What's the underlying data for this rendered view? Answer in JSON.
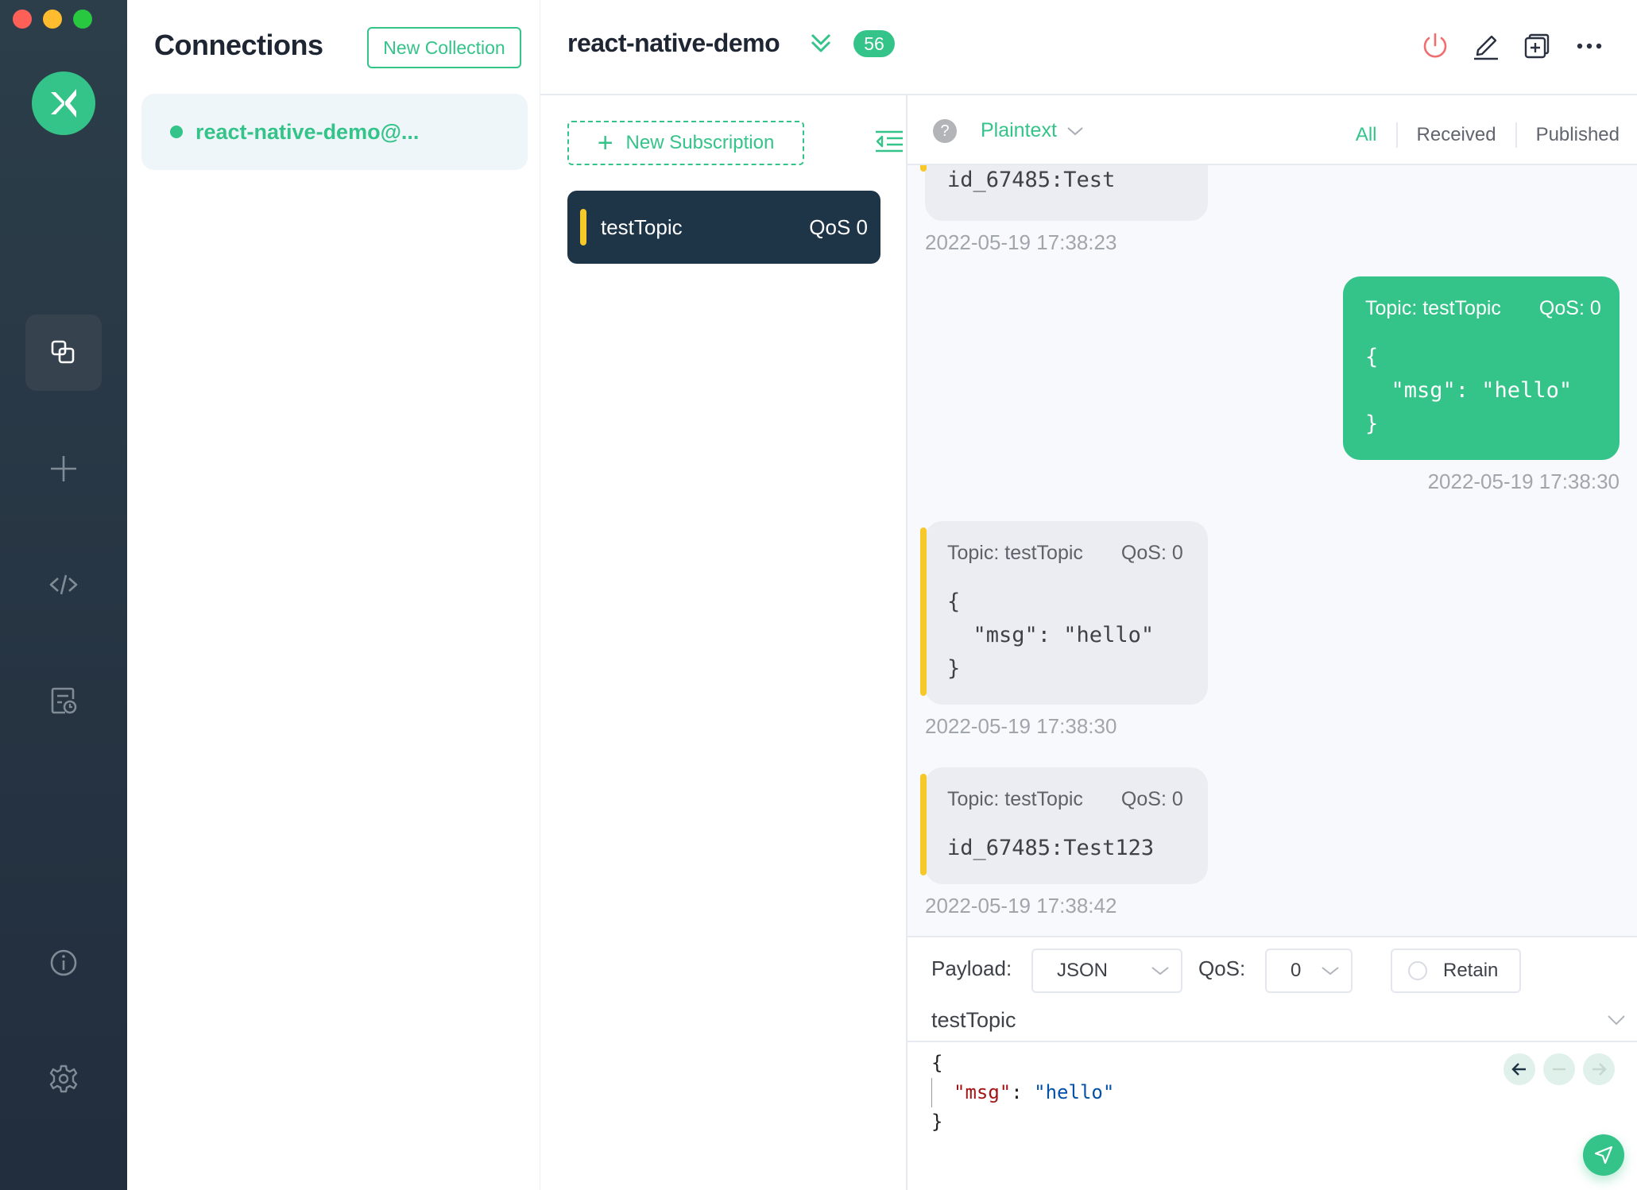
{
  "window": {
    "traffic_lights": [
      "close",
      "minimize",
      "maximize"
    ]
  },
  "nav": {
    "logo": "mqttx-logo",
    "items": [
      {
        "name": "connections",
        "icon": "connections-icon",
        "active": true
      },
      {
        "name": "new-connection",
        "icon": "plus-icon",
        "active": false
      },
      {
        "name": "script",
        "icon": "code-icon",
        "active": false
      },
      {
        "name": "log",
        "icon": "log-icon",
        "active": false
      },
      {
        "name": "about",
        "icon": "info-icon",
        "active": false
      },
      {
        "name": "settings",
        "icon": "gear-icon",
        "active": false
      }
    ]
  },
  "connections": {
    "title": "Connections",
    "new_collection_label": "New Collection",
    "items": [
      {
        "name": "react-native-demo@...",
        "status": "connected",
        "status_color": "#34c388"
      }
    ]
  },
  "header": {
    "connection_name": "react-native-demo",
    "message_count": "56",
    "actions": [
      "power-icon",
      "edit-icon",
      "new-window-icon",
      "more-icon"
    ]
  },
  "subscriptions": {
    "new_subscription_label": "New Subscription",
    "items": [
      {
        "topic": "testTopic",
        "qos": "QoS 0",
        "color": "#f7c82a"
      }
    ]
  },
  "messages": {
    "payload_type": "Plaintext",
    "filters": {
      "all": "All",
      "received": "Received",
      "published": "Published",
      "active": "All"
    },
    "list": [
      {
        "direction": "received",
        "topic": "",
        "qos": "",
        "payload": "id_67485:Test",
        "time": "2022-05-19 17:38:23"
      },
      {
        "direction": "sent",
        "topic": "Topic: testTopic",
        "qos": "QoS: 0",
        "payload": "{\n  \"msg\": \"hello\"\n}",
        "time": "2022-05-19 17:38:30"
      },
      {
        "direction": "received",
        "topic": "Topic: testTopic",
        "qos": "QoS: 0",
        "payload": "{\n  \"msg\": \"hello\"\n}",
        "time": "2022-05-19 17:38:30"
      },
      {
        "direction": "received",
        "topic": "Topic: testTopic",
        "qos": "QoS: 0",
        "payload": "id_67485:Test123",
        "time": "2022-05-19 17:38:42"
      }
    ]
  },
  "publish": {
    "payload_label": "Payload:",
    "payload_format": "JSON",
    "qos_label": "QoS:",
    "qos_value": "0",
    "retain_label": "Retain",
    "retain_checked": false,
    "topic": "testTopic",
    "editor": {
      "open": "{",
      "key": "\"msg\"",
      "colon": ": ",
      "value": "\"hello\"",
      "close": "}"
    }
  },
  "colors": {
    "accent": "#34c388",
    "sidebar": "#2b3a47",
    "subscription_active_bg": "#1e3447",
    "topic_marker": "#f7c82a",
    "disconnect": "#f26d6d"
  }
}
